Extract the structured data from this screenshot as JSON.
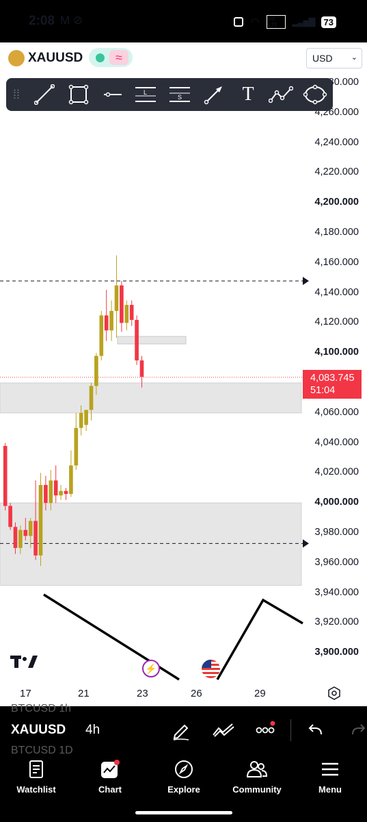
{
  "status_bar": {
    "time": "2:08",
    "left_icons": "M ⊘",
    "volte": "Vo LTE",
    "battery": "73"
  },
  "header": {
    "symbol": "XAUUSD",
    "currency": "USD",
    "status_wave": "≈"
  },
  "toolbar": {
    "icons": [
      "trend-line-icon",
      "rectangle-icon",
      "horizontal-line-icon",
      "long-position-icon",
      "short-position-icon",
      "arrow-icon",
      "text-icon",
      "path-icon",
      "circle-icon"
    ],
    "long_label": "L",
    "short_label": "S",
    "text_glyph": "T"
  },
  "chart": {
    "price_labels": [
      {
        "text": "4,280.000",
        "bold": false
      },
      {
        "text": "4,260.000",
        "bold": false
      },
      {
        "text": "4,240.000",
        "bold": false
      },
      {
        "text": "4,220.000",
        "bold": false
      },
      {
        "text": "4,200.000",
        "bold": true
      },
      {
        "text": "4,180.000",
        "bold": false
      },
      {
        "text": "4,160.000",
        "bold": false
      },
      {
        "text": "4,140.000",
        "bold": false
      },
      {
        "text": "4,120.000",
        "bold": false
      },
      {
        "text": "4,100.000",
        "bold": true
      },
      {
        "text": "4,080.000",
        "bold": false
      },
      {
        "text": "4,060.000",
        "bold": false
      },
      {
        "text": "4,040.000",
        "bold": false
      },
      {
        "text": "4,020.000",
        "bold": false
      },
      {
        "text": "4,000.000",
        "bold": true
      },
      {
        "text": "3,980.000",
        "bold": false
      },
      {
        "text": "3,960.000",
        "bold": false
      },
      {
        "text": "3,940.000",
        "bold": false
      },
      {
        "text": "3,920.000",
        "bold": false
      },
      {
        "text": "3,900.000",
        "bold": true
      }
    ],
    "current_price": "4,083.745",
    "countdown": "51:04",
    "time_labels": [
      "17",
      "21",
      "23",
      "26",
      "29"
    ],
    "colors": {
      "up": "#b9a21f",
      "down": "#f23645",
      "zone": "#e6e6e6"
    }
  },
  "chart_data": {
    "type": "candlestick",
    "candles": [
      {
        "o": 4038,
        "h": 4040,
        "l": 3995,
        "c": 3998
      },
      {
        "o": 3998,
        "h": 4000,
        "l": 3982,
        "c": 3984
      },
      {
        "o": 3984,
        "h": 3987,
        "l": 3966,
        "c": 3970
      },
      {
        "o": 3970,
        "h": 3985,
        "l": 3966,
        "c": 3982
      },
      {
        "o": 3982,
        "h": 3990,
        "l": 3975,
        "c": 3978
      },
      {
        "o": 3978,
        "h": 3990,
        "l": 3970,
        "c": 3988
      },
      {
        "o": 3988,
        "h": 4015,
        "l": 3962,
        "c": 3965
      },
      {
        "o": 3965,
        "h": 4020,
        "l": 3958,
        "c": 4012
      },
      {
        "o": 4012,
        "h": 4018,
        "l": 3995,
        "c": 4000
      },
      {
        "o": 4000,
        "h": 4022,
        "l": 3995,
        "c": 4015
      },
      {
        "o": 4015,
        "h": 4025,
        "l": 4000,
        "c": 4005
      },
      {
        "o": 4005,
        "h": 4012,
        "l": 4002,
        "c": 4008
      },
      {
        "o": 4008,
        "h": 4010,
        "l": 4002,
        "c": 4006
      },
      {
        "o": 4006,
        "h": 4035,
        "l": 4004,
        "c": 4025
      },
      {
        "o": 4025,
        "h": 4060,
        "l": 4022,
        "c": 4050
      },
      {
        "o": 4050,
        "h": 4065,
        "l": 4045,
        "c": 4060
      },
      {
        "o": 4052,
        "h": 4062,
        "l": 4048,
        "c": 4062
      },
      {
        "o": 4062,
        "h": 4080,
        "l": 4055,
        "c": 4078
      },
      {
        "o": 4078,
        "h": 4100,
        "l": 4072,
        "c": 4098
      },
      {
        "o": 4098,
        "h": 4128,
        "l": 4095,
        "c": 4125
      },
      {
        "o": 4125,
        "h": 4142,
        "l": 4108,
        "c": 4115
      },
      {
        "o": 4115,
        "h": 4135,
        "l": 4108,
        "c": 4128
      },
      {
        "o": 4128,
        "h": 4165,
        "l": 4110,
        "c": 4145
      },
      {
        "o": 4145,
        "h": 4148,
        "l": 4114,
        "c": 4120
      },
      {
        "o": 4120,
        "h": 4135,
        "l": 4115,
        "c": 4132
      },
      {
        "o": 4132,
        "h": 4135,
        "l": 4118,
        "c": 4122
      },
      {
        "o": 4122,
        "h": 4125,
        "l": 4092,
        "c": 4095
      },
      {
        "o": 4095,
        "h": 4098,
        "l": 4077,
        "c": 4084
      }
    ]
  },
  "trade_bar": {
    "ghost_top": "BTCUSD   1h",
    "symbol": "XAUUSD",
    "interval": "4h",
    "ghost_bottom": "BTCUSD   1D"
  },
  "nav": {
    "items": [
      {
        "label": "Watchlist"
      },
      {
        "label": "Chart"
      },
      {
        "label": "Explore"
      },
      {
        "label": "Community"
      },
      {
        "label": "Menu"
      }
    ]
  }
}
